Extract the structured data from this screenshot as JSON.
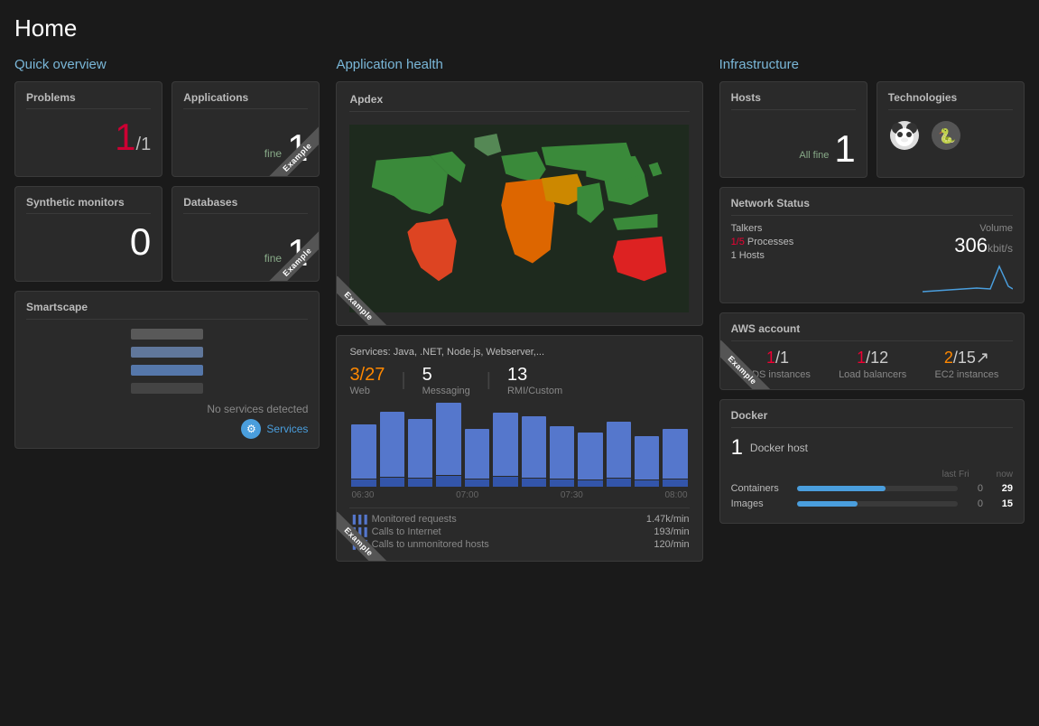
{
  "page": {
    "title": "Home"
  },
  "quick_overview": {
    "section_title": "Quick overview",
    "problems": {
      "title": "Problems",
      "value": "1",
      "sub": "/1",
      "color": "red"
    },
    "applications": {
      "title": "Applications",
      "status": "fine",
      "value": "1",
      "ribbon": "Example"
    },
    "synthetic_monitors": {
      "title": "Synthetic monitors",
      "value": "0"
    },
    "databases": {
      "title": "Databases",
      "status": "fine",
      "value": "1",
      "ribbon": "Example"
    },
    "smartscape": {
      "title": "Smartscape",
      "no_services": "No services detected",
      "services_link": "Services"
    }
  },
  "app_health": {
    "section_title": "Application health",
    "apdex_title": "Apdex",
    "services_header": "Services: Java, .NET, Node.js, Webserver,...",
    "web_value": "3/27",
    "web_label": "Web",
    "messaging_value": "5",
    "messaging_label": "Messaging",
    "rmi_value": "13",
    "rmi_label": "RMI/Custom",
    "chart_labels": [
      "06:30",
      "07:00",
      "07:30",
      "08:00"
    ],
    "metrics": [
      {
        "icon": "bar",
        "label": "Monitored requests",
        "value": "1.47k/min"
      },
      {
        "icon": "bar",
        "label": "Calls to Internet",
        "value": "193/min"
      },
      {
        "icon": "bar",
        "label": "Calls to unmonitored hosts",
        "value": "120/min"
      }
    ],
    "ribbon": "Example"
  },
  "infrastructure": {
    "section_title": "Infrastructure",
    "hosts": {
      "title": "Hosts",
      "status": "All fine",
      "value": "1"
    },
    "technologies": {
      "title": "Technologies"
    },
    "network_status": {
      "title": "Network Status",
      "talkers_label": "Talkers",
      "talkers_value": "1/5",
      "processes_label": "Processes",
      "hosts_value": "1",
      "hosts_label": "Hosts",
      "volume_label": "Volume",
      "volume_value": "306",
      "volume_unit": "kbit/s"
    },
    "aws": {
      "title": "AWS account",
      "rds_value": "1/1",
      "rds_label": "RDS instances",
      "lb_value": "1/12",
      "lb_label": "Load balancers",
      "ec2_value": "2/15",
      "ec2_label": "EC2 instances",
      "ribbon": "Example"
    },
    "docker": {
      "title": "Docker",
      "host_count": "1",
      "host_label": "Docker host",
      "last_col": "last Fri",
      "now_col": "now",
      "rows": [
        {
          "label": "Containers",
          "last": "0",
          "now": "29",
          "bar_pct": 55
        },
        {
          "label": "Images",
          "last": "0",
          "now": "15",
          "bar_pct": 38
        }
      ]
    }
  }
}
